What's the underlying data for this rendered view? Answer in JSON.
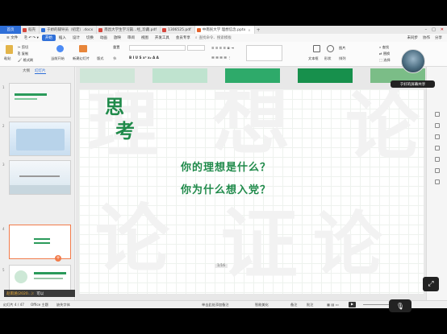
{
  "titlebar": {
    "home_label": "首页",
    "tabs": [
      {
        "label": "稻壳",
        "color": "#d6453b"
      },
      {
        "label": "于娇的辅导员（初定）.docx",
        "color": "#2f6fd8"
      },
      {
        "label": "南昌大学生学习篇...经_珍藏.pdf",
        "color": "#d6453b"
      },
      {
        "label": "1306525.pdf",
        "color": "#d6453b"
      },
      {
        "label": "中南民大学 理想信念.pptx",
        "color": "#e4622a"
      }
    ],
    "new_tab": "+"
  },
  "menubar": {
    "file": "文件",
    "items": [
      "开始",
      "插入",
      "设计",
      "切换",
      "动画",
      "放映",
      "审阅",
      "视图",
      "开发工具",
      "会员专享"
    ],
    "search": "查找命令、搜索模板",
    "right": [
      "未同步",
      "协作",
      "分享"
    ]
  },
  "ribbon": {
    "paste": "粘贴",
    "cut": "剪切",
    "copy": "复制",
    "format_painter": "格式刷",
    "from_current": "当前开始",
    "new_slide": "新建幻灯片",
    "layout": "版式",
    "section": "节",
    "reset": "重置",
    "find": "查找",
    "replace": "替换",
    "select": "选择",
    "textbox": "文本框",
    "shape": "形状",
    "arrange": "排列",
    "picture": "图片"
  },
  "leftpanel": {
    "tab_outline": "大纲",
    "tab_slides": "幻灯片",
    "slide_numbers": [
      "1",
      "2",
      "3",
      "4",
      "5"
    ]
  },
  "slide": {
    "think": [
      "思",
      "考"
    ],
    "question1": "你的理想是什么？",
    "question2": "你为什么想入党？",
    "page_indicator": "1/16"
  },
  "statusbar": {
    "slide_info": "幻灯片 4 / 47",
    "theme": "Office 主题",
    "font_missing": "缺失字体",
    "notes_hint": "单击此处添加备注",
    "smart_beautify": "智能美化",
    "notes": "备注",
    "comments": "批注"
  },
  "overlay": {
    "share_label": "于好的屏幕共享",
    "message_user": "赵雨涵(2020...):",
    "message_text": "可以",
    "fullscreen_icon": "⤢",
    "mic_icon": "🎙"
  },
  "colors": {
    "accent": "#2f6fd8",
    "green": "#1f8a4a",
    "swatches": [
      "#cfe6d8",
      "#bfe3cf",
      "#2eaa6a",
      "#17904c",
      "#7bbd87"
    ]
  }
}
